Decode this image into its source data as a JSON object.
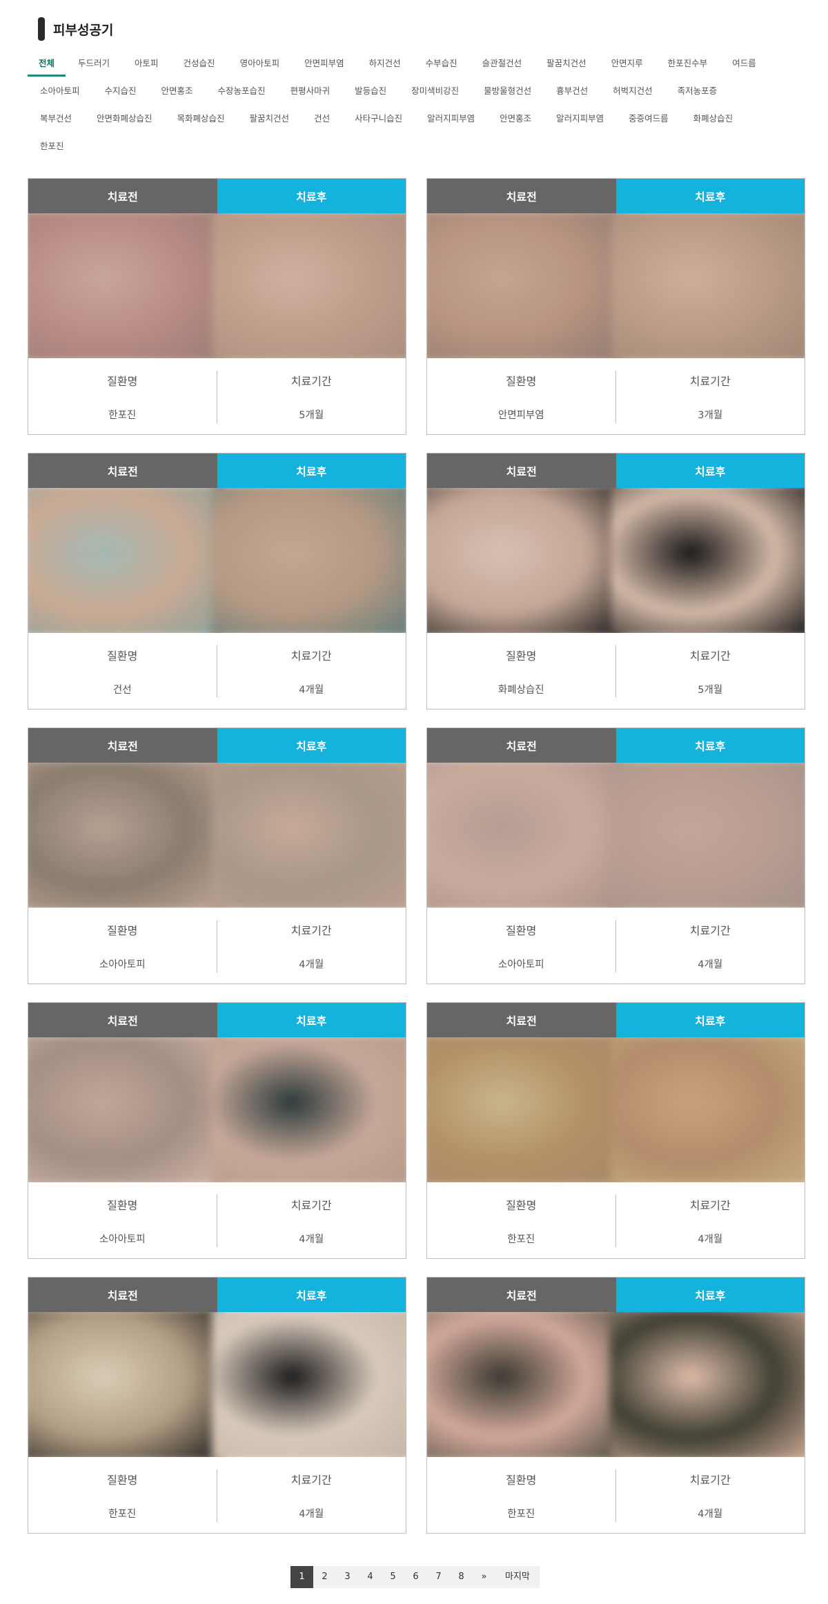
{
  "page": {
    "title": "피부성공기"
  },
  "categories": {
    "rows": [
      [
        "전체",
        "두드러기",
        "아토피",
        "건성습진",
        "영아아토피",
        "안면피부염",
        "하지건선",
        "수부습진",
        "슬관절건선",
        "팔꿈치건선",
        "안면지루",
        "한포진수부",
        "여드름"
      ],
      [
        "소아아토피",
        "수지습진",
        "안면홍조",
        "수장농포습진",
        "편평사마귀",
        "발등습진",
        "장미색비강진",
        "물방울형건선",
        "흉부건선",
        "허벅지건선",
        "족저농포증"
      ],
      [
        "복부건선",
        "안면화폐상습진",
        "목화폐상습진",
        "팔꿈치건선",
        "건선",
        "사타구니습진",
        "알러지피부염",
        "안면홍조",
        "알러지피부염",
        "중증여드름",
        "화폐상습진"
      ],
      [
        "한포진"
      ]
    ]
  },
  "card_labels": {
    "before": "치료전",
    "after": "치료후",
    "disease_label": "질환명",
    "period_label": "치료기간"
  },
  "cases": [
    {
      "disease": "한포진",
      "period": "5개월",
      "before_colors": [
        "#c9a59a",
        "#b88c85",
        "#9a7b72"
      ],
      "after_colors": [
        "#cfb09f",
        "#bf9c8a",
        "#a88d7e"
      ]
    },
    {
      "disease": "안면피부염",
      "period": "3개월",
      "before_colors": [
        "#c6a48f",
        "#b79380",
        "#8f7a6e"
      ],
      "after_colors": [
        "#ccae9a",
        "#b89a86",
        "#9e8673"
      ]
    },
    {
      "disease": "건선",
      "period": "4개월",
      "before_colors": [
        "#a4b8b4",
        "#c9aa93",
        "#8aa19c"
      ],
      "after_colors": [
        "#c3a793",
        "#b59983",
        "#607c7a"
      ]
    },
    {
      "disease": "화폐상습진",
      "period": "5개월",
      "before_colors": [
        "#d7bfb0",
        "#c4a796",
        "#141414"
      ],
      "after_colors": [
        "#1a1a1a",
        "#d4b9a7",
        "#111111"
      ]
    },
    {
      "disease": "소아아토피",
      "period": "4개월",
      "before_colors": [
        "#b7a092",
        "#8a7d6e",
        "#c3a695"
      ],
      "after_colors": [
        "#c7aa98",
        "#a89788",
        "#bc9f8e"
      ]
    },
    {
      "disease": "소아아토피",
      "period": "4개월",
      "before_colors": [
        "#b59e92",
        "#c9ab9d",
        "#a89084"
      ],
      "after_colors": [
        "#c3a69a",
        "#b89d90",
        "#a4908a"
      ]
    },
    {
      "disease": "소아아토피",
      "period": "4개월",
      "before_colors": [
        "#bfa798",
        "#a58f82",
        "#d0b8a9"
      ],
      "after_colors": [
        "#2c3a3c",
        "#c6a898",
        "#b69988"
      ]
    },
    {
      "disease": "한포진",
      "period": "4개월",
      "before_colors": [
        "#c9b58a",
        "#b39067",
        "#a98968"
      ],
      "after_colors": [
        "#c9a27c",
        "#b38d6c",
        "#c6ad7f"
      ]
    },
    {
      "disease": "한포진",
      "period": "4개월",
      "before_colors": [
        "#d9cdb5",
        "#b39e84",
        "#1a1a1a"
      ],
      "after_colors": [
        "#1c1c1c",
        "#d7c9bb",
        "#c4b3a3"
      ]
    },
    {
      "disease": "한포진",
      "period": "4개월",
      "before_colors": [
        "#3a3a32",
        "#d3a99a",
        "#4a4a3e"
      ],
      "after_colors": [
        "#e0bca8",
        "#3f4034",
        "#d4ad98"
      ]
    }
  ],
  "pagination": {
    "pages": [
      "1",
      "2",
      "3",
      "4",
      "5",
      "6",
      "7",
      "8"
    ],
    "current": "1",
    "next": "»",
    "last": "마지막"
  }
}
